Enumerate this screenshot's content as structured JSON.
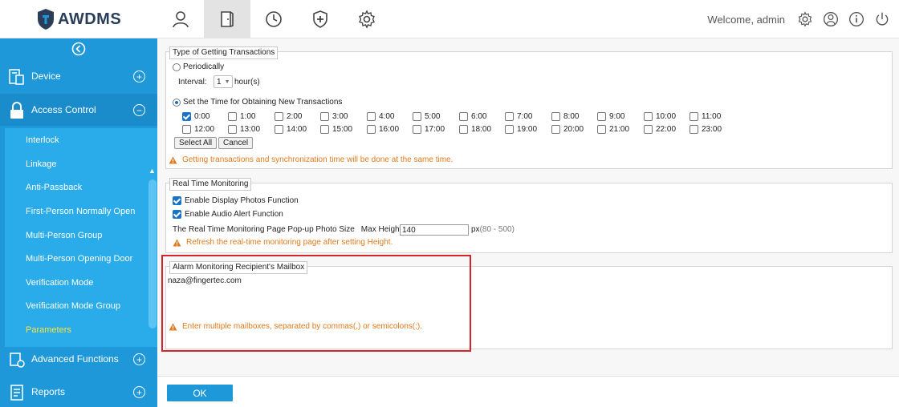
{
  "app": {
    "name": "AWDMS",
    "welcome": "Welcome, admin"
  },
  "topnav": [
    {
      "icon": "person-icon"
    },
    {
      "icon": "door-icon",
      "active": true
    },
    {
      "icon": "clock-icon"
    },
    {
      "icon": "shield-plus-icon"
    },
    {
      "icon": "gear-icon"
    }
  ],
  "sidebar": {
    "device": "Device",
    "access_control": "Access Control",
    "submenu": [
      "Interlock",
      "Linkage",
      "Anti-Passback",
      "First-Person Normally Open",
      "Multi-Person Group",
      "Multi-Person Opening Door",
      "Verification Mode",
      "Verification Mode Group",
      "Parameters"
    ],
    "active_sub": "Parameters",
    "advanced": "Advanced Functions",
    "reports": "Reports"
  },
  "transactions": {
    "legend": "Type of Getting Transactions",
    "periodically": "Periodically",
    "interval_label": "Interval:",
    "interval_value": "1",
    "interval_unit": "hour(s)",
    "set_time": "Set the Time for Obtaining New Transactions",
    "hours_row1": [
      "0:00",
      "1:00",
      "2:00",
      "3:00",
      "4:00",
      "5:00",
      "6:00",
      "7:00",
      "8:00",
      "9:00",
      "10:00",
      "11:00"
    ],
    "hours_row2": [
      "12:00",
      "13:00",
      "14:00",
      "15:00",
      "16:00",
      "17:00",
      "18:00",
      "19:00",
      "20:00",
      "21:00",
      "22:00",
      "23:00"
    ],
    "checked": [
      "0:00"
    ],
    "select_all": "Select All",
    "cancel": "Cancel",
    "warning": "Getting transactions and synchronization time will be done at the same time."
  },
  "realtime": {
    "legend": "Real Time Monitoring",
    "display_photos": "Enable Display Photos Function",
    "audio_alert": "Enable Audio Alert Function",
    "photo_size_label": "The Real Time Monitoring Page Pop-up Photo Size",
    "max_height_label": "Max Height:",
    "max_height_value": "140",
    "unit": "px",
    "range": "(80 - 500)",
    "warning": "Refresh the real-time monitoring page after setting Height."
  },
  "alarm": {
    "legend": "Alarm Monitoring Recipient's Mailbox",
    "mailbox": "naza@fingertec.com",
    "warning": "Enter multiple mailboxes, separated by commas(,) or semicolons(;)."
  },
  "footer": {
    "ok": "OK"
  },
  "colors": {
    "sidebar": "#1e98d8",
    "submenu": "#2aabea",
    "active_sub": "#ffe23a",
    "warning": "#e07a1c",
    "highlight": "#d8232a"
  }
}
